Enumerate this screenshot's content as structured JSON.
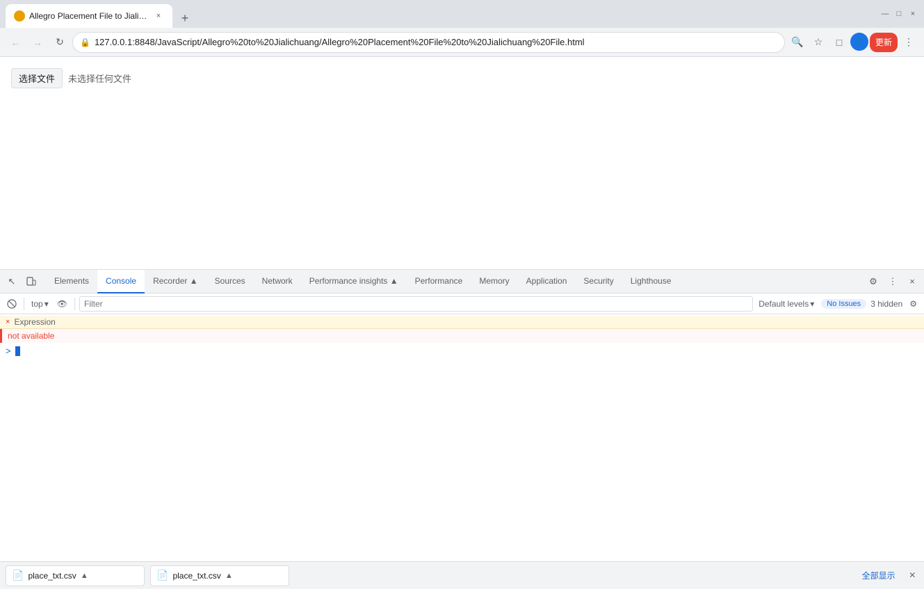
{
  "browser": {
    "tab": {
      "favicon_color": "#e8a000",
      "title": "Allegro Placement File to Jialic...",
      "close_label": "×"
    },
    "new_tab_label": "+",
    "window_controls": {
      "minimize": "—",
      "maximize": "□",
      "close": "×"
    }
  },
  "navbar": {
    "back_label": "←",
    "forward_label": "→",
    "refresh_label": "↻",
    "url": "127.0.0.1:8848/JavaScript/Allegro%20to%20Jialichuang/Allegro%20Placement%20File%20to%20Jialichuang%20File.html",
    "zoom_label": "🔍",
    "bookmark_label": "☆",
    "extensions_label": "□",
    "profile_label": "👤",
    "update_label": "更新",
    "menu_label": "⋮"
  },
  "page": {
    "file_btn_label": "选择文件",
    "file_placeholder": "未选择任何文件"
  },
  "devtools": {
    "left_icons": [
      {
        "name": "cursor-icon",
        "symbol": "↖"
      },
      {
        "name": "mobile-icon",
        "symbol": "📱"
      }
    ],
    "tabs": [
      {
        "id": "elements",
        "label": "Elements",
        "active": false
      },
      {
        "id": "console",
        "label": "Console",
        "active": true
      },
      {
        "id": "recorder",
        "label": "Recorder ▲",
        "active": false
      },
      {
        "id": "sources",
        "label": "Sources",
        "active": false
      },
      {
        "id": "network",
        "label": "Network",
        "active": false
      },
      {
        "id": "performance-insights",
        "label": "Performance insights ▲",
        "active": false
      },
      {
        "id": "performance",
        "label": "Performance",
        "active": false
      },
      {
        "id": "memory",
        "label": "Memory",
        "active": false
      },
      {
        "id": "application",
        "label": "Application",
        "active": false
      },
      {
        "id": "security",
        "label": "Security",
        "active": false
      },
      {
        "id": "lighthouse",
        "label": "Lighthouse",
        "active": false
      }
    ],
    "right_icons": [
      {
        "name": "settings-icon",
        "symbol": "⚙"
      },
      {
        "name": "more-icon",
        "symbol": "⋮"
      },
      {
        "name": "close-devtools-icon",
        "symbol": "×"
      }
    ],
    "console": {
      "toolbar": {
        "clear_label": "🚫",
        "top_label": "top",
        "top_chevron": "▾",
        "eye_label": "👁",
        "filter_placeholder": "Filter",
        "default_levels": "Default levels",
        "levels_chevron": "▾",
        "no_issues": "No Issues",
        "hidden_count": "3 hidden",
        "settings_label": "⚙"
      },
      "expression_label": "Expression",
      "expression_x": "×",
      "error_message": "not available",
      "prompt_symbol": ">"
    }
  },
  "downloads": [
    {
      "icon": "📄",
      "name": "place_txt.csv",
      "chevron": "▲"
    },
    {
      "icon": "📄",
      "name": "place_txt.csv",
      "chevron": "▲"
    }
  ],
  "status_bar": {
    "show_all": "全部显示",
    "close": "×"
  }
}
